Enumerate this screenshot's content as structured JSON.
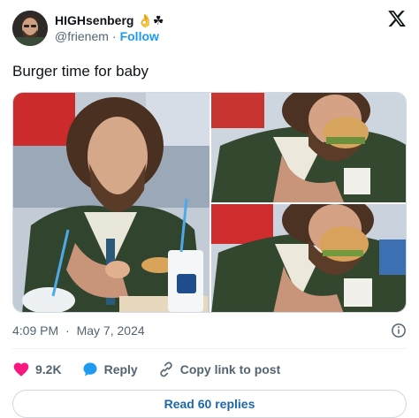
{
  "user": {
    "display_name": "HIGHsenberg",
    "emoji": "👌☘",
    "handle": "@frienem",
    "separator": "·",
    "follow_label": "Follow"
  },
  "tweet": {
    "text": "Burger time for baby",
    "time": "4:09 PM",
    "separator": "·",
    "date": "May 7, 2024"
  },
  "media": {
    "photos": [
      {
        "name": "man-looking-at-burger-photo"
      },
      {
        "name": "man-biting-burger-photo-1"
      },
      {
        "name": "man-biting-burger-photo-2"
      }
    ]
  },
  "actions": {
    "like_count": "9.2K",
    "reply_label": "Reply",
    "copy_link_label": "Copy link to post"
  },
  "footer": {
    "read_replies_label": "Read 60 replies"
  },
  "colors": {
    "accent": "#1d9bf0",
    "like": "#f91880",
    "reply": "#1d9bf0",
    "muted": "#536471"
  },
  "icons": [
    "x-logo-icon",
    "info-icon",
    "heart-icon",
    "reply-bubble-icon",
    "link-icon"
  ]
}
